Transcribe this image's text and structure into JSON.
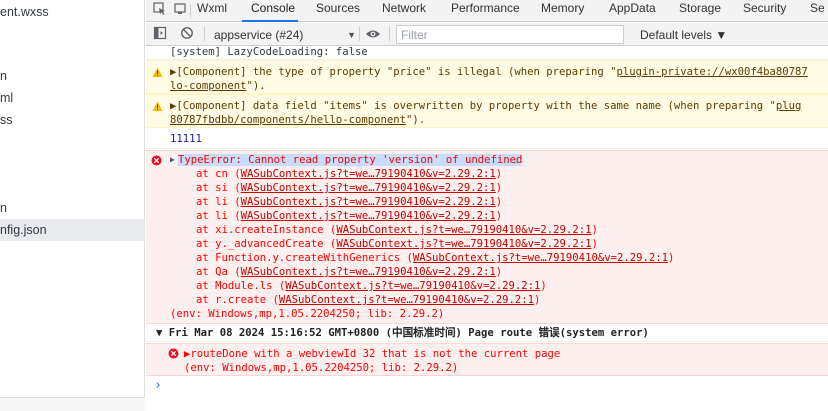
{
  "file_panel": {
    "items": [
      {
        "label": "ent.wxss",
        "selected": false
      },
      {
        "label": "n",
        "selected": false
      },
      {
        "label": "ml",
        "selected": false
      },
      {
        "label": "ss",
        "selected": false
      },
      {
        "label": "n",
        "selected": false
      },
      {
        "label": "nfig.json",
        "selected": true
      }
    ]
  },
  "tabs": [
    "Wxml",
    "Console",
    "Sources",
    "Network",
    "Performance",
    "Memory",
    "AppData",
    "Storage",
    "Security",
    "Se"
  ],
  "active_tab": "Console",
  "toolbar": {
    "context": "appservice (#24)",
    "filter_placeholder": "Filter",
    "levels": "Default levels ▼"
  },
  "console": {
    "system_line": "[system] LazyCodeLoading: false",
    "warn1": {
      "text": "▶[Component] the type of property \"price\" is illegal (when preparing \"",
      "link": "plugin-private://wx00f4ba80787",
      "cont_link": "lo-component",
      "cont_tail": "\")."
    },
    "warn2": {
      "text": "▶[Component] data field \"items\" is overwritten by property with the same name (when preparing \"",
      "link": "plug",
      "cont_link": "80787fbdbb/components/hello-component",
      "cont_tail": "\")."
    },
    "log_value": "11111",
    "error1": {
      "title": "TypeError: Cannot read property 'version' of undefined",
      "frames": [
        {
          "fn": "at cn (",
          "src": "WASubContext.js?t=we…79190410&v=2.29.2:1",
          "end": ")"
        },
        {
          "fn": "at si (",
          "src": "WASubContext.js?t=we…79190410&v=2.29.2:1",
          "end": ")"
        },
        {
          "fn": "at li (",
          "src": "WASubContext.js?t=we…79190410&v=2.29.2:1",
          "end": ")"
        },
        {
          "fn": "at li (",
          "src": "WASubContext.js?t=we…79190410&v=2.29.2:1",
          "end": ")"
        },
        {
          "fn": "at xi.createInstance (",
          "src": "WASubContext.js?t=we…79190410&v=2.29.2:1",
          "end": ")"
        },
        {
          "fn": "at y._advancedCreate (",
          "src": "WASubContext.js?t=we…79190410&v=2.29.2:1",
          "end": ")"
        },
        {
          "fn": "at Function.y.createWithGenerics (",
          "src": "WASubContext.js?t=we…79190410&v=2.29.2:1",
          "end": ")"
        },
        {
          "fn": "at Qa (",
          "src": "WASubContext.js?t=we…79190410&v=2.29.2:1",
          "end": ")"
        },
        {
          "fn": "at Module.ls (",
          "src": "WASubContext.js?t=we…79190410&v=2.29.2:1",
          "end": ")"
        },
        {
          "fn": "at r.create (",
          "src": "WASubContext.js?t=we…79190410&v=2.29.2:1",
          "end": ")"
        }
      ],
      "env": "(env: Windows,mp,1.05.2204250; lib: 2.29.2)"
    },
    "group_header": "▼ Fri Mar 08 2024 15:16:52 GMT+0800 (中国标准时间) Page route 错误(system error)",
    "error2": {
      "text": "▶routeDone with a webviewId 32 that is not the current page",
      "env": "(env: Windows,mp,1.05.2204250; lib: 2.29.2)"
    },
    "prompt": "›"
  },
  "colors": {
    "error_bg": "#fff0f0",
    "error_text": "#ff0000",
    "warning_bg": "#fffbe5",
    "warning_text": "#5c3c00",
    "active_tab_underline": "#1a73e8",
    "log_value": "#1a1aa6"
  }
}
